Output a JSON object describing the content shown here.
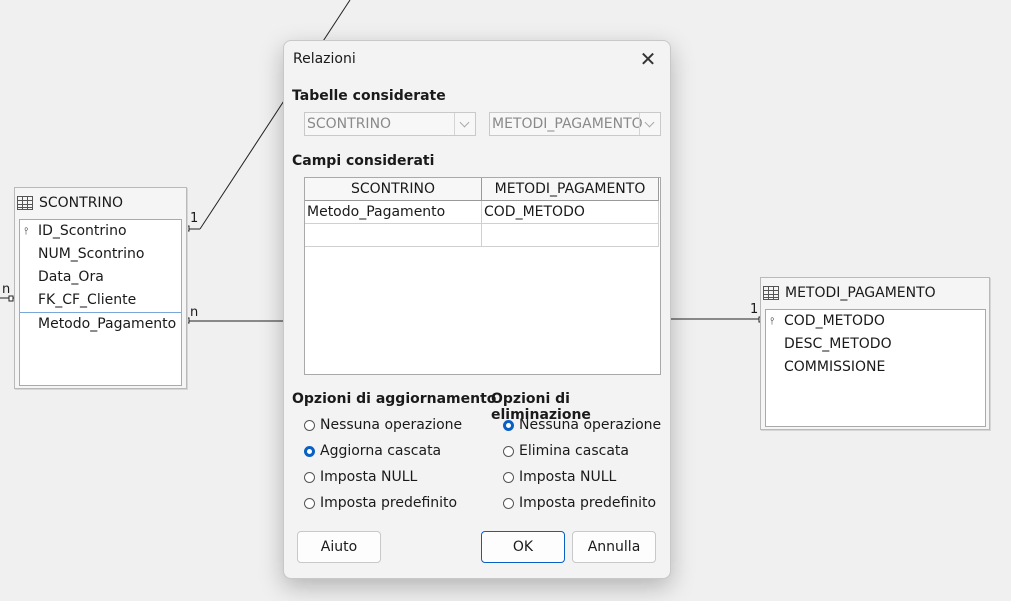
{
  "diagram": {
    "tables": [
      {
        "name": "SCONTRINO",
        "fields": [
          {
            "label": "ID_Scontrino",
            "key": true
          },
          {
            "label": "NUM_Scontrino",
            "key": false
          },
          {
            "label": "Data_Ora",
            "key": false
          },
          {
            "label": "FK_CF_Cliente",
            "key": false
          },
          {
            "label": "Metodo_Pagamento",
            "key": false
          }
        ]
      },
      {
        "name": "METODI_PAGAMENTO",
        "fields": [
          {
            "label": "COD_METODO",
            "key": true
          },
          {
            "label": "DESC_METODO",
            "key": false
          },
          {
            "label": "COMMISSIONE",
            "key": false
          }
        ]
      }
    ],
    "cardinality": {
      "scontrino_top": "1",
      "scontrino_left": "n",
      "scontrino_right": "n",
      "metodi_left": "1"
    },
    "key_glyph": "⫯"
  },
  "dialog": {
    "title": "Relazioni",
    "close_glyph": "✕",
    "tables_section": "Tabelle considerate",
    "table_left": "SCONTRINO",
    "table_right": "METODI_PAGAMENTO",
    "fields_section": "Campi considerati",
    "grid": {
      "headers": [
        "SCONTRINO",
        "METODI_PAGAMENTO"
      ],
      "rows": [
        [
          "Metodo_Pagamento",
          "COD_METODO"
        ],
        [
          "",
          ""
        ]
      ]
    },
    "update_section": "Opzioni di aggiornamento",
    "update_options": [
      {
        "label": "Nessuna operazione",
        "selected": false
      },
      {
        "label": "Aggiorna cascata",
        "selected": true
      },
      {
        "label": "Imposta NULL",
        "selected": false
      },
      {
        "label": "Imposta predefinito",
        "selected": false
      }
    ],
    "delete_section": "Opzioni di eliminazione",
    "delete_options": [
      {
        "label": "Nessuna operazione",
        "selected": true
      },
      {
        "label": "Elimina cascata",
        "selected": false
      },
      {
        "label": "Imposta NULL",
        "selected": false
      },
      {
        "label": "Imposta predefinito",
        "selected": false
      }
    ],
    "buttons": {
      "help": "Aiuto",
      "ok": "OK",
      "cancel": "Annulla"
    }
  },
  "colors": {
    "accent": "#0a5fc4",
    "background": "#f0f0f0"
  }
}
